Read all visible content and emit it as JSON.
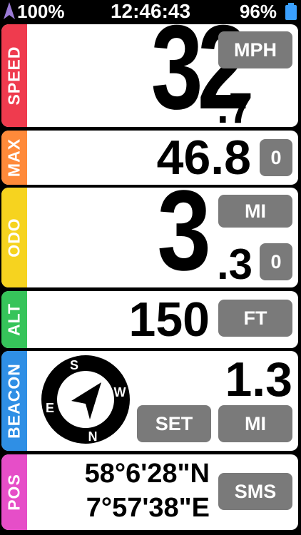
{
  "status": {
    "signal": "100%",
    "time": "12:46:43",
    "battery": "96%",
    "colors": {
      "gps_arrow": "#9b7bd6",
      "battery": "#3aa0ff"
    }
  },
  "speed": {
    "label": "SPEED",
    "integer": "32",
    "decimal": ".7",
    "unit": "MPH",
    "color": "#ef3b4e"
  },
  "max": {
    "label": "MAX",
    "value": "46.8",
    "reset": "0",
    "color": "#ff8a3a"
  },
  "odo": {
    "label": "ODO",
    "integer": "3",
    "decimal": ".3",
    "unit": "MI",
    "reset": "0",
    "color": "#f6d31f"
  },
  "alt": {
    "label": "ALT",
    "value": "150",
    "unit": "FT",
    "color": "#36c45a"
  },
  "beacon": {
    "label": "BEACON",
    "value": "1.3",
    "set": "SET",
    "unit": "MI",
    "color": "#2f8fe5",
    "compass": {
      "n": "N",
      "s": "S",
      "e": "E",
      "w": "W"
    }
  },
  "pos": {
    "label": "POS",
    "lat": "58°6'28\"N",
    "lon": "7°57'38\"E",
    "sms": "SMS",
    "color": "#e64ec8"
  }
}
